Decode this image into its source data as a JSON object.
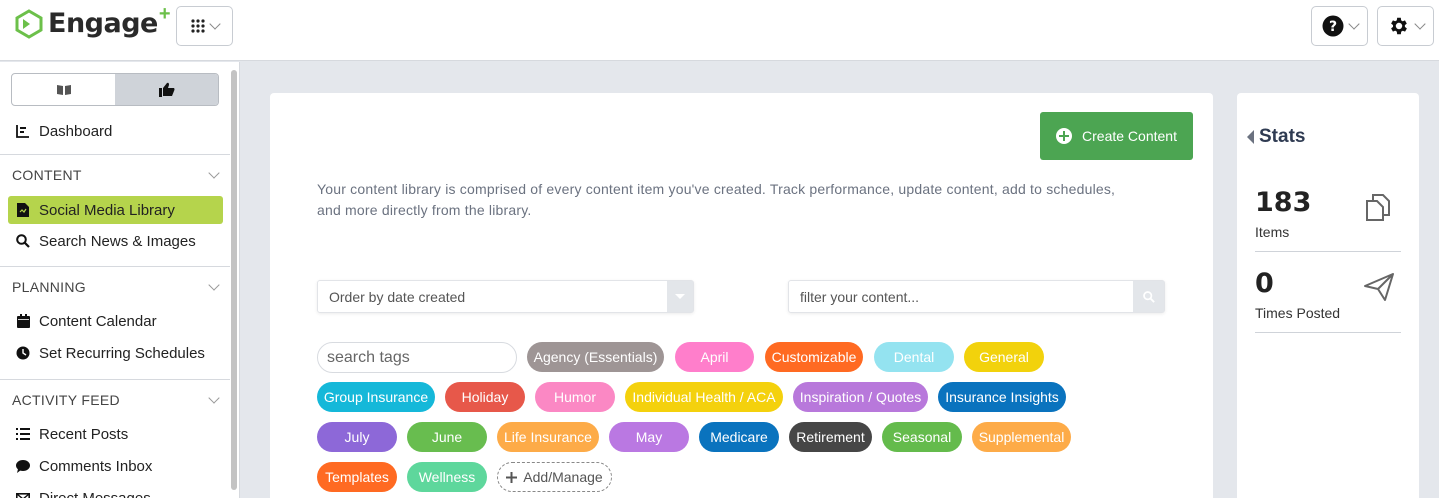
{
  "header": {
    "logo_text": "Engage",
    "logo_plus": "+",
    "apps_icon": "grid-icon",
    "help_icon": "question-circle-icon",
    "settings_icon": "gear-icon"
  },
  "sidebar": {
    "dashboard": "Dashboard",
    "sections": {
      "content": "CONTENT",
      "planning": "PLANNING",
      "activity": "ACTIVITY FEED"
    },
    "content_items": [
      "Social Media Library",
      "Search News & Images"
    ],
    "planning_items": [
      "Content Calendar",
      "Set Recurring Schedules"
    ],
    "activity_items": [
      "Recent Posts",
      "Comments Inbox",
      "Direct Messages"
    ],
    "accent_color": "#b5d44c"
  },
  "main": {
    "create_button": "Create Content",
    "description": "Your content library is comprised of every content item you've created. Track performance, update content, add to schedules, and more directly from the library.",
    "order_select": "Order by date created",
    "filter_placeholder": "filter your content...",
    "tag_search_placeholder": "search tags",
    "tags": [
      {
        "label": "Agency (Essentials)",
        "color": "#9e9595"
      },
      {
        "label": "April",
        "color": "#ff7ecb"
      },
      {
        "label": "Customizable",
        "color": "#ff6a22"
      },
      {
        "label": "Dental",
        "color": "#94e3f0"
      },
      {
        "label": "General",
        "color": "#f2d20c"
      },
      {
        "label": "Group Insurance",
        "color": "#15b8d9"
      },
      {
        "label": "Holiday",
        "color": "#e7584a"
      },
      {
        "label": "Humor",
        "color": "#fb88c4"
      },
      {
        "label": "Individual Health / ACA",
        "color": "#f4d10d"
      },
      {
        "label": "Inspiration / Quotes",
        "color": "#b878db"
      },
      {
        "label": "Insurance Insights",
        "color": "#0a73be"
      },
      {
        "label": "July",
        "color": "#8d68d8"
      },
      {
        "label": "June",
        "color": "#68bd4f"
      },
      {
        "label": "Life Insurance",
        "color": "#fdab48"
      },
      {
        "label": "May",
        "color": "#ba78e2"
      },
      {
        "label": "Medicare",
        "color": "#0a73be"
      },
      {
        "label": "Retirement",
        "color": "#464646"
      },
      {
        "label": "Seasonal",
        "color": "#64bb4c"
      },
      {
        "label": "Supplemental",
        "color": "#fdab48"
      },
      {
        "label": "Templates",
        "color": "#ff6a22"
      },
      {
        "label": "Wellness",
        "color": "#5ed79c"
      }
    ],
    "add_manage": "Add/Manage",
    "create_color": "#4ca552"
  },
  "stats": {
    "title": "Stats",
    "items_count": "183",
    "items_label": "Items",
    "posted_count": "0",
    "posted_label": "Times Posted"
  }
}
